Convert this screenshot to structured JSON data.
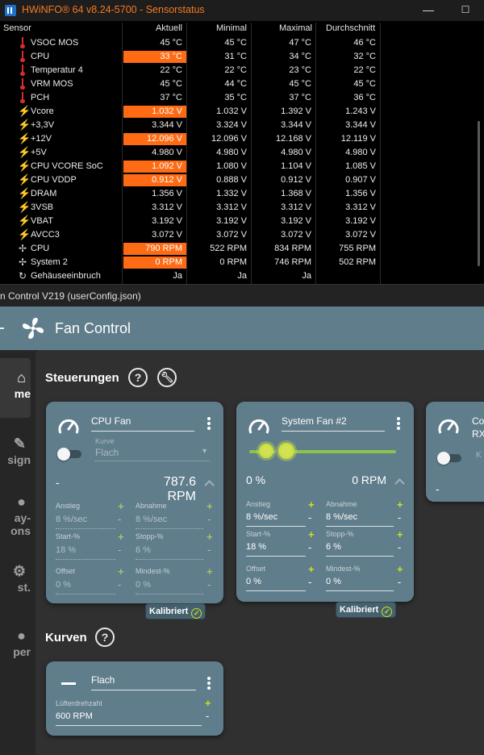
{
  "hwinfo": {
    "title": "HWiNFO® 64 v8.24-5700 - Sensorstatus",
    "columns": [
      "Sensor",
      "Aktuell",
      "Minimal",
      "Maximal",
      "Durchschnitt"
    ],
    "rows": [
      {
        "icon": "thermometer-icon",
        "name": "VSOC MOS",
        "cur": "45 °C",
        "min": "45 °C",
        "max": "47 °C",
        "avg": "46 °C",
        "highlight": false
      },
      {
        "icon": "thermometer-icon",
        "name": "CPU",
        "cur": "33 °C",
        "min": "31 °C",
        "max": "34 °C",
        "avg": "32 °C",
        "highlight": true
      },
      {
        "icon": "thermometer-icon",
        "name": "Temperatur 4",
        "cur": "22 °C",
        "min": "22 °C",
        "max": "23 °C",
        "avg": "22 °C",
        "highlight": false
      },
      {
        "icon": "thermometer-icon",
        "name": "VRM MOS",
        "cur": "45 °C",
        "min": "44 °C",
        "max": "45 °C",
        "avg": "45 °C",
        "highlight": false
      },
      {
        "icon": "thermometer-icon",
        "name": "PCH",
        "cur": "37 °C",
        "min": "35 °C",
        "max": "37 °C",
        "avg": "36 °C",
        "highlight": false
      },
      {
        "icon": "lightning-icon",
        "name": "Vcore",
        "cur": "1.032 V",
        "min": "1.032 V",
        "max": "1.392 V",
        "avg": "1.243 V",
        "highlight": true
      },
      {
        "icon": "lightning-icon",
        "name": "+3,3V",
        "cur": "3.344 V",
        "min": "3.324 V",
        "max": "3.344 V",
        "avg": "3.344 V",
        "highlight": false
      },
      {
        "icon": "lightning-icon",
        "name": "+12V",
        "cur": "12.096 V",
        "min": "12.096 V",
        "max": "12.168 V",
        "avg": "12.119 V",
        "highlight": true
      },
      {
        "icon": "lightning-icon",
        "name": "+5V",
        "cur": "4.980 V",
        "min": "4.980 V",
        "max": "4.980 V",
        "avg": "4.980 V",
        "highlight": false
      },
      {
        "icon": "lightning-icon",
        "name": "CPU VCORE SoC",
        "cur": "1.092 V",
        "min": "1.080 V",
        "max": "1.104 V",
        "avg": "1.085 V",
        "highlight": true
      },
      {
        "icon": "lightning-icon",
        "name": "CPU VDDP",
        "cur": "0.912 V",
        "min": "0.888 V",
        "max": "0.912 V",
        "avg": "0.907 V",
        "highlight": true
      },
      {
        "icon": "lightning-icon",
        "name": "DRAM",
        "cur": "1.356 V",
        "min": "1.332 V",
        "max": "1.368 V",
        "avg": "1.356 V",
        "highlight": false
      },
      {
        "icon": "lightning-icon",
        "name": "3VSB",
        "cur": "3.312 V",
        "min": "3.312 V",
        "max": "3.312 V",
        "avg": "3.312 V",
        "highlight": false
      },
      {
        "icon": "lightning-icon",
        "name": "VBAT",
        "cur": "3.192 V",
        "min": "3.192 V",
        "max": "3.192 V",
        "avg": "3.192 V",
        "highlight": false
      },
      {
        "icon": "lightning-icon",
        "name": "AVCC3",
        "cur": "3.072 V",
        "min": "3.072 V",
        "max": "3.072 V",
        "avg": "3.072 V",
        "highlight": false
      },
      {
        "icon": "fan-icon",
        "name": "CPU",
        "cur": "790 RPM",
        "min": "522 RPM",
        "max": "834 RPM",
        "avg": "755 RPM",
        "highlight": true
      },
      {
        "icon": "fan-icon",
        "name": "System 2",
        "cur": "0 RPM",
        "min": "0 RPM",
        "max": "746 RPM",
        "avg": "502 RPM",
        "highlight": true
      },
      {
        "icon": "intrusion-icon",
        "name": "Gehäuseeinbruch",
        "cur": "Ja",
        "min": "Ja",
        "max": "Ja",
        "avg": "",
        "highlight": false
      }
    ]
  },
  "fancontrol": {
    "window_title": "n Control V219 (userConfig.json)",
    "app_title": "Fan Control",
    "sidebar": [
      {
        "icon": "home-icon",
        "label": "me",
        "active": true
      },
      {
        "icon": "design-icon",
        "label": "sign",
        "active": false
      },
      {
        "icon": "display-icon",
        "label": "ay-",
        "label2": "ons",
        "active": false
      },
      {
        "icon": "settings-icon",
        "label": "st.",
        "active": false
      },
      {
        "icon": "info-icon",
        "label": "per",
        "active": false
      }
    ],
    "controls_title": "Steuerungen",
    "curves_title": "Kurven",
    "help_icon": "?",
    "cards": {
      "cpu": {
        "name": "CPU Fan",
        "curve_label": "Kurve",
        "curve_value": "Flach",
        "percent": "-",
        "rpm": "787.6 RPM",
        "step_up_label": "Anstieg",
        "step_up": "8 %/sec",
        "step_down_label": "Abnahme",
        "step_down": "8 %/sec",
        "start_label": "Start-%",
        "start": "18 %",
        "stop_label": "Stopp-%",
        "stop": "6 %",
        "offset_label": "Offset",
        "offset": "0 %",
        "min_label": "Mindest-%",
        "min": "0 %",
        "calibrated": "Kalibriert"
      },
      "sys2": {
        "name": "System Fan #2",
        "percent": "0 %",
        "rpm": "0 RPM",
        "step_up_label": "Anstieg",
        "step_up": "8 %/sec",
        "step_down_label": "Abnahme",
        "step_down": "8 %/sec",
        "start_label": "Start-%",
        "start": "18 %",
        "stop_label": "Stopp-%",
        "stop": "6 %",
        "offset_label": "Offset",
        "offset": "0 %",
        "min_label": "Mindest-%",
        "min": "0 %",
        "calibrated": "Kalibriert",
        "slider_value_percent": 0
      },
      "third": {
        "name_line1": "Co",
        "name_line2": "RX",
        "curve_label": "K",
        "percent": "-"
      }
    },
    "curve_card": {
      "name": "Flach",
      "speed_label": "Lüfterdrehzahl",
      "speed_value": "600 RPM"
    },
    "colors": {
      "card": "#607d8b",
      "accent": "#c9e31f",
      "highlight": "#ff6a14",
      "title_orange": "#f47920"
    }
  }
}
